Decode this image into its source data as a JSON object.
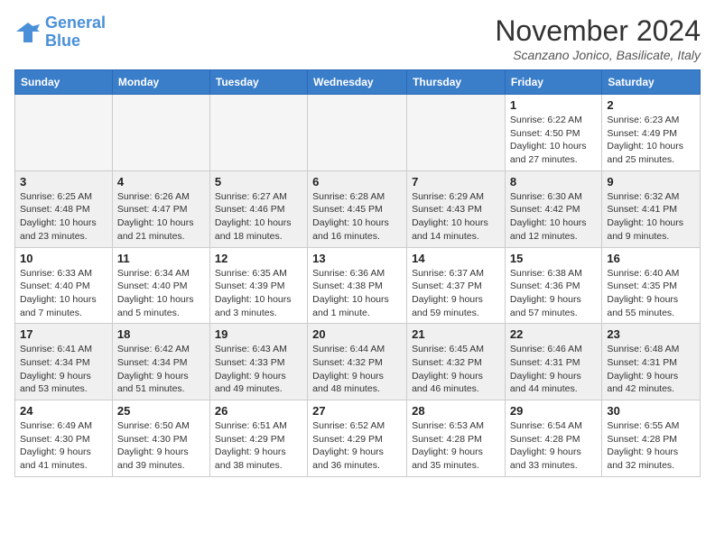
{
  "header": {
    "logo_line1": "General",
    "logo_line2": "Blue",
    "month": "November 2024",
    "location": "Scanzano Jonico, Basilicate, Italy"
  },
  "days_of_week": [
    "Sunday",
    "Monday",
    "Tuesday",
    "Wednesday",
    "Thursday",
    "Friday",
    "Saturday"
  ],
  "weeks": [
    [
      {
        "day": "",
        "info": ""
      },
      {
        "day": "",
        "info": ""
      },
      {
        "day": "",
        "info": ""
      },
      {
        "day": "",
        "info": ""
      },
      {
        "day": "",
        "info": ""
      },
      {
        "day": "1",
        "info": "Sunrise: 6:22 AM\nSunset: 4:50 PM\nDaylight: 10 hours and 27 minutes."
      },
      {
        "day": "2",
        "info": "Sunrise: 6:23 AM\nSunset: 4:49 PM\nDaylight: 10 hours and 25 minutes."
      }
    ],
    [
      {
        "day": "3",
        "info": "Sunrise: 6:25 AM\nSunset: 4:48 PM\nDaylight: 10 hours and 23 minutes."
      },
      {
        "day": "4",
        "info": "Sunrise: 6:26 AM\nSunset: 4:47 PM\nDaylight: 10 hours and 21 minutes."
      },
      {
        "day": "5",
        "info": "Sunrise: 6:27 AM\nSunset: 4:46 PM\nDaylight: 10 hours and 18 minutes."
      },
      {
        "day": "6",
        "info": "Sunrise: 6:28 AM\nSunset: 4:45 PM\nDaylight: 10 hours and 16 minutes."
      },
      {
        "day": "7",
        "info": "Sunrise: 6:29 AM\nSunset: 4:43 PM\nDaylight: 10 hours and 14 minutes."
      },
      {
        "day": "8",
        "info": "Sunrise: 6:30 AM\nSunset: 4:42 PM\nDaylight: 10 hours and 12 minutes."
      },
      {
        "day": "9",
        "info": "Sunrise: 6:32 AM\nSunset: 4:41 PM\nDaylight: 10 hours and 9 minutes."
      }
    ],
    [
      {
        "day": "10",
        "info": "Sunrise: 6:33 AM\nSunset: 4:40 PM\nDaylight: 10 hours and 7 minutes."
      },
      {
        "day": "11",
        "info": "Sunrise: 6:34 AM\nSunset: 4:40 PM\nDaylight: 10 hours and 5 minutes."
      },
      {
        "day": "12",
        "info": "Sunrise: 6:35 AM\nSunset: 4:39 PM\nDaylight: 10 hours and 3 minutes."
      },
      {
        "day": "13",
        "info": "Sunrise: 6:36 AM\nSunset: 4:38 PM\nDaylight: 10 hours and 1 minute."
      },
      {
        "day": "14",
        "info": "Sunrise: 6:37 AM\nSunset: 4:37 PM\nDaylight: 9 hours and 59 minutes."
      },
      {
        "day": "15",
        "info": "Sunrise: 6:38 AM\nSunset: 4:36 PM\nDaylight: 9 hours and 57 minutes."
      },
      {
        "day": "16",
        "info": "Sunrise: 6:40 AM\nSunset: 4:35 PM\nDaylight: 9 hours and 55 minutes."
      }
    ],
    [
      {
        "day": "17",
        "info": "Sunrise: 6:41 AM\nSunset: 4:34 PM\nDaylight: 9 hours and 53 minutes."
      },
      {
        "day": "18",
        "info": "Sunrise: 6:42 AM\nSunset: 4:34 PM\nDaylight: 9 hours and 51 minutes."
      },
      {
        "day": "19",
        "info": "Sunrise: 6:43 AM\nSunset: 4:33 PM\nDaylight: 9 hours and 49 minutes."
      },
      {
        "day": "20",
        "info": "Sunrise: 6:44 AM\nSunset: 4:32 PM\nDaylight: 9 hours and 48 minutes."
      },
      {
        "day": "21",
        "info": "Sunrise: 6:45 AM\nSunset: 4:32 PM\nDaylight: 9 hours and 46 minutes."
      },
      {
        "day": "22",
        "info": "Sunrise: 6:46 AM\nSunset: 4:31 PM\nDaylight: 9 hours and 44 minutes."
      },
      {
        "day": "23",
        "info": "Sunrise: 6:48 AM\nSunset: 4:31 PM\nDaylight: 9 hours and 42 minutes."
      }
    ],
    [
      {
        "day": "24",
        "info": "Sunrise: 6:49 AM\nSunset: 4:30 PM\nDaylight: 9 hours and 41 minutes."
      },
      {
        "day": "25",
        "info": "Sunrise: 6:50 AM\nSunset: 4:30 PM\nDaylight: 9 hours and 39 minutes."
      },
      {
        "day": "26",
        "info": "Sunrise: 6:51 AM\nSunset: 4:29 PM\nDaylight: 9 hours and 38 minutes."
      },
      {
        "day": "27",
        "info": "Sunrise: 6:52 AM\nSunset: 4:29 PM\nDaylight: 9 hours and 36 minutes."
      },
      {
        "day": "28",
        "info": "Sunrise: 6:53 AM\nSunset: 4:28 PM\nDaylight: 9 hours and 35 minutes."
      },
      {
        "day": "29",
        "info": "Sunrise: 6:54 AM\nSunset: 4:28 PM\nDaylight: 9 hours and 33 minutes."
      },
      {
        "day": "30",
        "info": "Sunrise: 6:55 AM\nSunset: 4:28 PM\nDaylight: 9 hours and 32 minutes."
      }
    ]
  ]
}
